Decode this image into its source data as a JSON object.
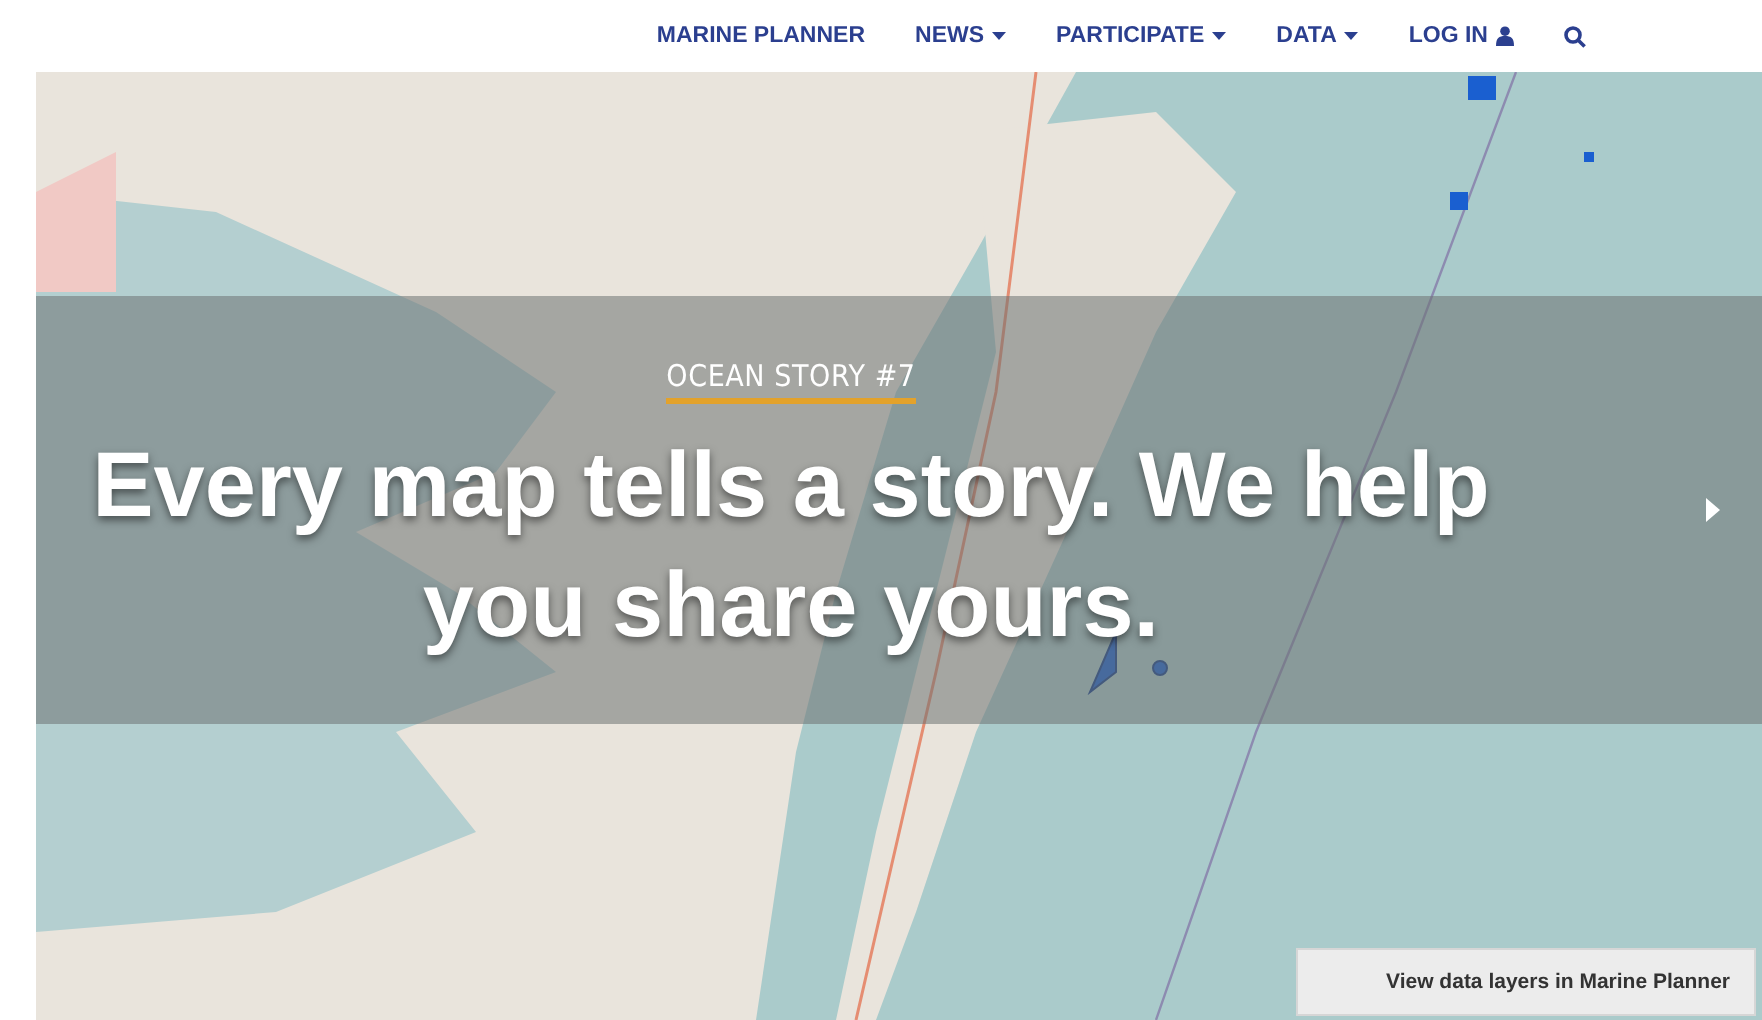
{
  "nav": [
    {
      "label": "MARINE PLANNER",
      "kind": "link"
    },
    {
      "label": "NEWS",
      "kind": "dropdown"
    },
    {
      "label": "PARTICIPATE",
      "kind": "dropdown"
    },
    {
      "label": "DATA",
      "kind": "dropdown"
    },
    {
      "label": "LOG IN",
      "kind": "login"
    },
    {
      "kind": "search"
    }
  ],
  "hero": {
    "eyebrow": "OCEAN STORY #7",
    "headline": "Every map tells a story. We help you share yours."
  },
  "map_button": "View data layers in Marine Planner"
}
